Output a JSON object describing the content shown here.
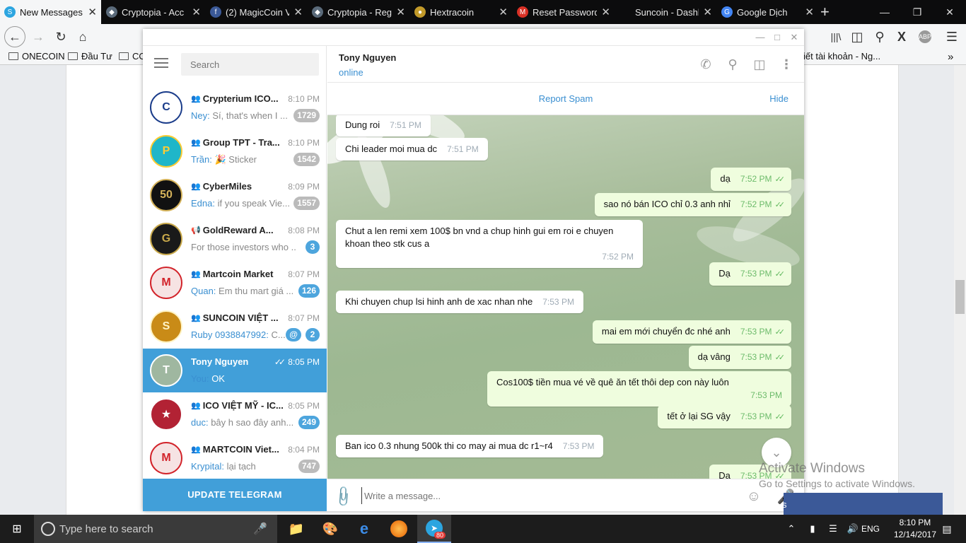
{
  "browser": {
    "tabs": [
      {
        "label": "New Messages...",
        "active": true,
        "icon": "telegram-icon"
      },
      {
        "label": "Cryptopia - Acc",
        "icon": "cryptopia-icon"
      },
      {
        "label": "(2) MagicCoin V",
        "icon": "facebook-icon"
      },
      {
        "label": "Cryptopia - Reg",
        "icon": "cryptopia-icon"
      },
      {
        "label": "Hextracoin",
        "icon": "coin-icon"
      },
      {
        "label": "Reset Password",
        "icon": "gmail-icon"
      },
      {
        "label": "Suncoin - Dashboar",
        "icon": "none"
      },
      {
        "label": "Google Dịch",
        "icon": "translate-icon"
      }
    ],
    "bookmarks": [
      "ONECOIN",
      "Đầu Tư",
      "CO"
    ],
    "bookmark_right": "iết tài khoản - Ng..."
  },
  "telegram": {
    "search_placeholder": "Search",
    "update_label": "UPDATE TELEGRAM",
    "chats": [
      {
        "name": "Crypterium ICO...",
        "time": "8:10 PM",
        "sender": "Ney:",
        "preview": "Sí, that's when I ...",
        "badge": "1729",
        "group": true,
        "avatar_bg": "#ffffff",
        "avatar_fg": "#1a3c8a",
        "avatar_text": "C"
      },
      {
        "name": "Group TPT - Tra...",
        "time": "8:10 PM",
        "sender": "Trần:",
        "preview": "🎉 Sticker",
        "badge": "1542",
        "group": true,
        "avatar_bg": "#1fb6c9",
        "avatar_fg": "#ffcc33",
        "avatar_text": "P"
      },
      {
        "name": "CyberMiles",
        "time": "8:09 PM",
        "sender": "Edna:",
        "preview": "if you speak Vie...",
        "badge": "1557",
        "group": true,
        "avatar_bg": "#111111",
        "avatar_fg": "#d4b25a",
        "avatar_text": "50"
      },
      {
        "name": "GoldReward A...",
        "time": "8:08 PM",
        "sender": "",
        "preview": "For those investors who ...",
        "badge": "3",
        "badge_blue": true,
        "channel": true,
        "avatar_bg": "#1a1a1a",
        "avatar_fg": "#c8a84a",
        "avatar_text": "G"
      },
      {
        "name": "Martcoin Market",
        "time": "8:07 PM",
        "sender": "Quan:",
        "preview": "Em thu mart giá ...",
        "badge": "126",
        "badge_blue": true,
        "group": true,
        "avatar_bg": "#f6e3e3",
        "avatar_fg": "#d2232a",
        "avatar_text": "M"
      },
      {
        "name": "SUNCOIN VIỆT ...",
        "time": "8:07 PM",
        "sender": "Ruby 0938847992:",
        "preview": "C...",
        "badge": "2",
        "badge_blue": true,
        "mention": "@",
        "group": true,
        "avatar_bg": "#c98b17",
        "avatar_fg": "#fff3c4",
        "avatar_text": "S"
      },
      {
        "name": "Tony Nguyen",
        "time": "8:05 PM",
        "sender": "You:",
        "preview": "OK",
        "badge": "",
        "selected": true,
        "read": true,
        "avatar_bg": "#9fb7a0",
        "avatar_fg": "#ffffff",
        "avatar_text": "T"
      },
      {
        "name": "ICO VIỆT MỸ - IC...",
        "time": "8:05 PM",
        "sender": "duc:",
        "preview": "bây h sao đây anh...",
        "badge": "249",
        "badge_blue": true,
        "group": true,
        "avatar_bg": "#b22234",
        "avatar_fg": "#ffffff",
        "avatar_text": "★"
      },
      {
        "name": "MARTCOIN Viet...",
        "time": "8:04 PM",
        "sender": "Krypital:",
        "preview": "lại tạch",
        "badge": "747",
        "group": true,
        "avatar_bg": "#f6e3e3",
        "avatar_fg": "#d2232a",
        "avatar_text": "M"
      }
    ],
    "header": {
      "name": "Tony Nguyen",
      "status": "online"
    },
    "banner": {
      "report": "Report Spam",
      "hide": "Hide"
    },
    "messages": [
      {
        "dir": "in",
        "text": "Dung roi",
        "time": "7:51 PM"
      },
      {
        "dir": "in",
        "text": "Chi leader moi mua dc",
        "time": "7:51 PM"
      },
      {
        "dir": "out",
        "text": "dạ",
        "time": "7:52 PM"
      },
      {
        "dir": "out",
        "text": "sao nó bán ICO chỉ 0.3 anh nhỉ",
        "time": "7:52 PM"
      },
      {
        "dir": "in",
        "text": "Chut a len remi xem 100$ bn vnd a chup hinh gui em roi e chuyen khoan theo stk cus a",
        "time": "7:52 PM"
      },
      {
        "dir": "out",
        "text": "Dạ",
        "time": "7:53 PM"
      },
      {
        "dir": "in",
        "text": "Khi chuyen chup lsi hinh anh de xac nhan nhe",
        "time": "7:53 PM"
      },
      {
        "dir": "out",
        "text": "mai em mới chuyển đc nhé anh",
        "time": "7:53 PM"
      },
      {
        "dir": "out",
        "text": "dạ vâng",
        "time": "7:53 PM"
      },
      {
        "dir": "out",
        "text": "Cos100$ tiền mua vé về quê ăn tết thôi dep con này luôn",
        "time": "7:53 PM"
      },
      {
        "dir": "out",
        "text": "tết ở lại SG vậy",
        "time": "7:53 PM"
      },
      {
        "dir": "in",
        "text": "Ban ico 0.3 nhung 500k thi co may ai mua dc r1~r4",
        "time": "7:53 PM"
      },
      {
        "dir": "out",
        "text": "Dạ",
        "time": "7:53 PM"
      }
    ],
    "composer_placeholder": "Write a message..."
  },
  "overlay": {
    "activate_title": "Activate Windows",
    "activate_sub": "Go to Settings to activate Windows.",
    "fb_button": "s"
  },
  "taskbar": {
    "search_placeholder": "Type here to search",
    "telegram_badge": "80",
    "lang": "ENG",
    "time": "8:10 PM",
    "date": "12/14/2017"
  }
}
